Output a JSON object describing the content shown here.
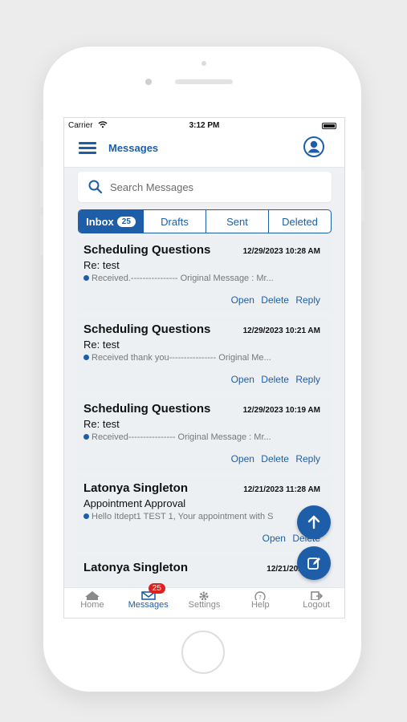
{
  "status": {
    "carrier": "Carrier",
    "time": "3:12 PM"
  },
  "header": {
    "title": "Messages",
    "menu_icon": "hamburger-icon",
    "profile_icon": "user-circle-icon"
  },
  "search": {
    "placeholder": "Search Messages"
  },
  "tabs": [
    {
      "label": "Inbox",
      "badge": "25"
    },
    {
      "label": "Drafts"
    },
    {
      "label": "Sent"
    },
    {
      "label": "Deleted"
    }
  ],
  "messages": [
    {
      "from": "Scheduling Questions",
      "date": "12/29/2023 10:28 AM",
      "subject": "Re: test",
      "preview": "Received.---------------- Original Message : Mr...",
      "actions": [
        "Open",
        "Delete",
        "Reply"
      ]
    },
    {
      "from": "Scheduling Questions",
      "date": "12/29/2023 10:21 AM",
      "subject": "Re: test",
      "preview": "Received thank you---------------- Original Me...",
      "actions": [
        "Open",
        "Delete",
        "Reply"
      ]
    },
    {
      "from": "Scheduling Questions",
      "date": "12/29/2023 10:19 AM",
      "subject": "Re: test",
      "preview": "Received---------------- Original Message : Mr...",
      "actions": [
        "Open",
        "Delete",
        "Reply"
      ]
    },
    {
      "from": "Latonya Singleton",
      "date": "12/21/2023 11:28 AM",
      "subject": "Appointment Approval",
      "preview": "Hello Itdept1 TEST 1, Your appointment with S",
      "actions": [
        "Open",
        "Delete"
      ]
    },
    {
      "from": "Latonya Singleton",
      "date": "12/21/2023 11:",
      "subject": "",
      "preview": "",
      "actions": []
    }
  ],
  "tabbar": {
    "items": [
      {
        "label": "Home",
        "icon": "home-icon"
      },
      {
        "label": "Messages",
        "icon": "mail-icon",
        "badge": "25"
      },
      {
        "label": "Settings",
        "icon": "gear-icon"
      },
      {
        "label": "Help",
        "icon": "help-icon"
      },
      {
        "label": "Logout",
        "icon": "logout-icon"
      }
    ]
  },
  "colors": {
    "accent": "#1e5ea8",
    "badge": "#e0201c"
  }
}
